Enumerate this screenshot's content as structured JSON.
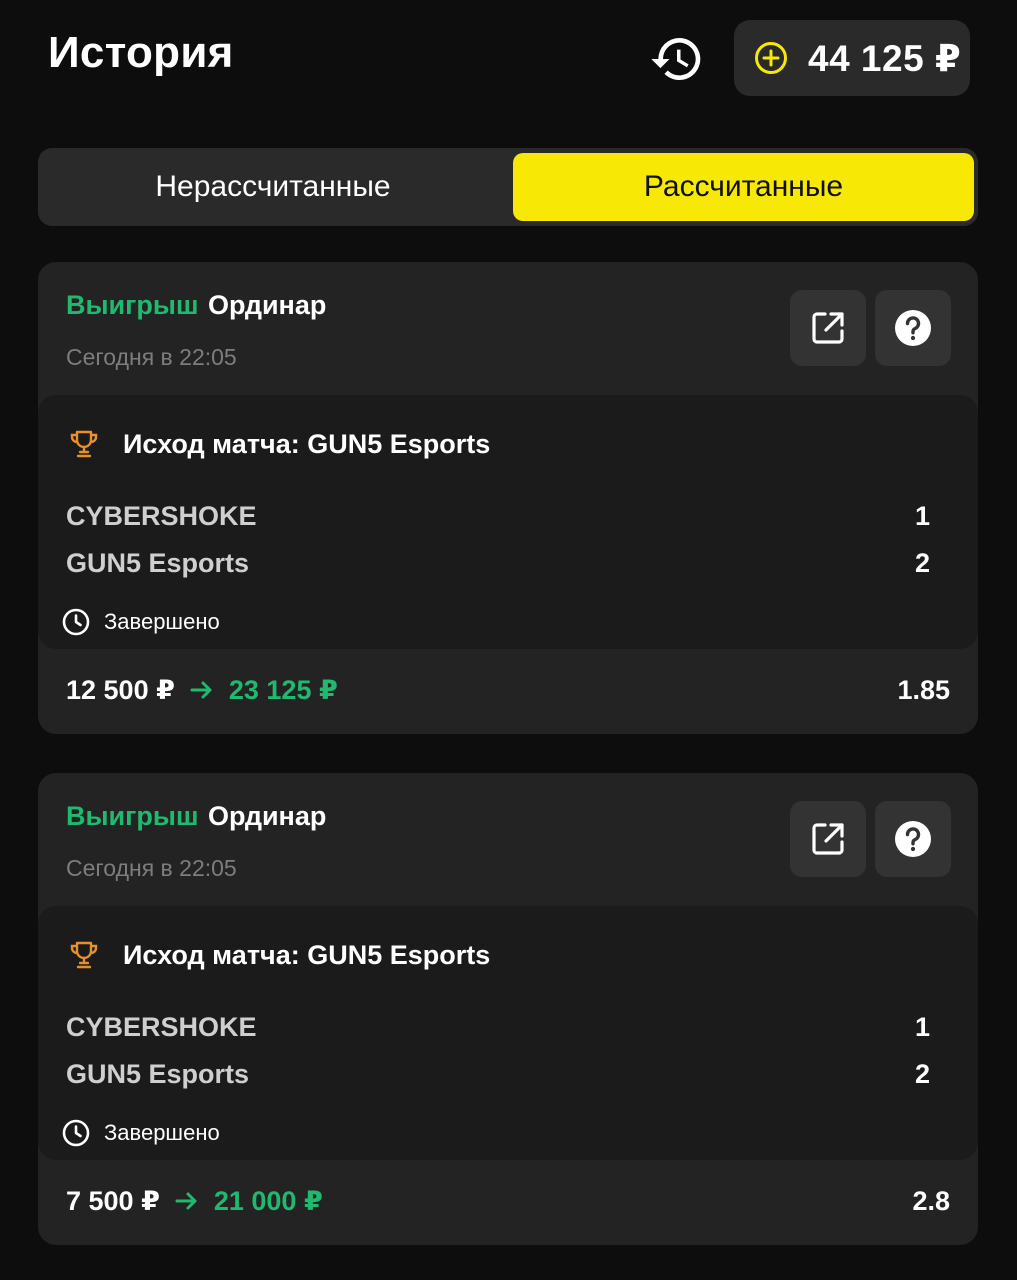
{
  "header": {
    "title": "История",
    "history_icon": "history-icon",
    "balance": "44 125 ₽",
    "balance_icon": "plus-circle-icon"
  },
  "tabs": [
    {
      "label": "Нерассчитанные",
      "active": false
    },
    {
      "label": "Рассчитанные",
      "active": true
    }
  ],
  "bets": [
    {
      "status": "Выигрыш",
      "type": "Ординар",
      "time": "Сегодня в 22:05",
      "market": "Исход матча: GUN5 Esports",
      "team1": "CYBERSHOKE",
      "score1": "1",
      "team2": "GUN5 Esports",
      "score2": "2",
      "state": "Завершено",
      "stake": "12 500 ₽",
      "payout": "23 125 ₽",
      "odds": "1.85"
    },
    {
      "status": "Выигрыш",
      "type": "Ординар",
      "time": "Сегодня в 22:05",
      "market": "Исход матча: GUN5 Esports",
      "team1": "CYBERSHOKE",
      "score1": "1",
      "team2": "GUN5 Esports",
      "score2": "2",
      "state": "Завершено",
      "stake": "7 500 ₽",
      "payout": "21 000 ₽",
      "odds": "2.8"
    }
  ],
  "colors": {
    "accent_yellow": "#f8e805",
    "win_green": "#1fba6f",
    "trophy_orange": "#e5902a",
    "background": "#0d0d0d",
    "card": "#232323"
  }
}
